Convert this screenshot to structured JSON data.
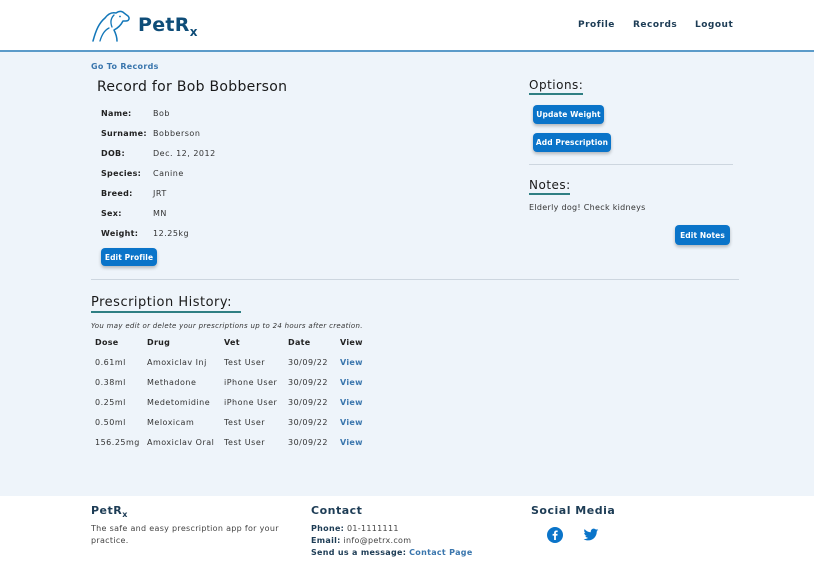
{
  "header": {
    "logo_text": "PetR",
    "logo_sub": "x",
    "nav": [
      "Profile",
      "Records",
      "Logout"
    ]
  },
  "main": {
    "back_link": "Go To Records",
    "title": "Record for Bob Bobberson",
    "fields": [
      {
        "label": "Name:",
        "value": "Bob"
      },
      {
        "label": "Surname:",
        "value": "Bobberson"
      },
      {
        "label": "DOB:",
        "value": "Dec. 12, 2012"
      },
      {
        "label": "Species:",
        "value": "Canine"
      },
      {
        "label": "Breed:",
        "value": "JRT"
      },
      {
        "label": "Sex:",
        "value": "MN"
      },
      {
        "label": "Weight:",
        "value": "12.25kg"
      }
    ],
    "edit_profile_label": "Edit Profile",
    "options": {
      "heading": "Options:",
      "update_weight_label": "Update Weight",
      "add_prescription_label": "Add Prescription"
    },
    "notes": {
      "heading": "Notes:",
      "text": "Elderly dog! Check kidneys",
      "edit_label": "Edit Notes"
    },
    "prescriptions": {
      "heading": "Prescription History:",
      "note": "You may edit or delete your prescriptions up to 24 hours after creation.",
      "columns": [
        "Dose",
        "Drug",
        "Vet",
        "Date",
        "View"
      ],
      "rows": [
        {
          "dose": "0.61ml",
          "drug": "Amoxiclav Inj",
          "vet": "Test User",
          "date": "30/09/22",
          "view": "View"
        },
        {
          "dose": "0.38ml",
          "drug": "Methadone",
          "vet": "iPhone User",
          "date": "30/09/22",
          "view": "View"
        },
        {
          "dose": "0.25ml",
          "drug": "Medetomidine",
          "vet": "iPhone User",
          "date": "30/09/22",
          "view": "View"
        },
        {
          "dose": "0.50ml",
          "drug": "Meloxicam",
          "vet": "Test User",
          "date": "30/09/22",
          "view": "View"
        },
        {
          "dose": "156.25mg",
          "drug": "Amoxiclav Oral",
          "vet": "Test User",
          "date": "30/09/22",
          "view": "View"
        }
      ]
    }
  },
  "footer": {
    "brand": "PetR",
    "brand_sub": "x",
    "tagline_1": "The safe and easy prescription app for your",
    "tagline_2": "practice.",
    "contact_heading": "Contact",
    "phone_label": "Phone:",
    "phone": "01-1111111",
    "email_label": "Email:",
    "email": "info@petrx.com",
    "message_label": "Send us a message:",
    "message_link": "Contact Page",
    "social_heading": "Social Media",
    "social_icons": [
      "facebook-icon",
      "twitter-icon"
    ]
  },
  "colors": {
    "brand_navy": "#0f4d78",
    "button_blue": "#0a74c9",
    "link_blue": "#3a76ad",
    "heading_underline": "#2f7f83",
    "page_background": "#eef4fa"
  }
}
